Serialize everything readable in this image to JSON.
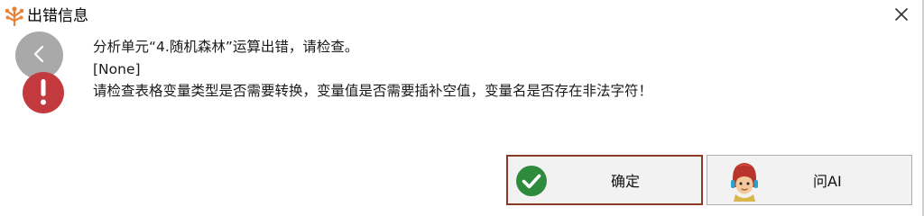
{
  "dialog": {
    "title": "出错信息"
  },
  "message": {
    "line1": "分析单元“4.随机森林”运算出错，请检查。",
    "line2": "[None]",
    "line3": "请检查表格变量类型是否需要转换，变量值是否需要插补空值，变量名是否存在非法字符！"
  },
  "buttons": {
    "ok_label": "确定",
    "ask_ai_label": "问AI"
  },
  "icons": {
    "app": "tree-logo-icon",
    "close": "close-icon",
    "back": "chevron-left-icon",
    "error": "exclamation-icon",
    "ok": "check-circle-icon",
    "ai": "avatar-icon"
  },
  "colors": {
    "error_red": "#c2393e",
    "ok_green": "#2e8b3e",
    "focus_border": "#8b3a26",
    "back_gray": "#a9a9a9",
    "app_orange": "#e8833a"
  }
}
